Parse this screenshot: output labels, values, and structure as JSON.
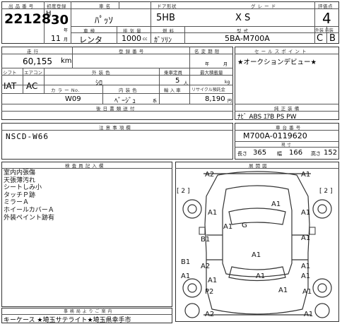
{
  "labels": {
    "lot_no": "出 品 番 号",
    "first_reg": "初度登録",
    "car_name": "車 名",
    "door": "ドア形状",
    "grade": "グ レ ー ド",
    "score": "評価点",
    "shaken": "車 検",
    "displacement": "排 気 量",
    "fuel": "燃 料",
    "model_type": "型 式",
    "ext_int": "外装 内装",
    "mileage": "走 行",
    "reg_no": "登 録 番 号",
    "name_change": "名 変 期 限",
    "sales_point": "セ ー ル ス ポ イ ン ト",
    "shift": "シフト",
    "ac": "エアコン",
    "ext_color": "外 装 色",
    "capacity": "乗車定員",
    "max_load": "最大積載量",
    "color_no": "カ ラ ー No.",
    "int_color": "内 装 色",
    "import": "輸 入 車",
    "recycle": "リサイクル預託金",
    "rear_equipment": "後 日 書 類 送 付",
    "genuine_equip": "純 正 装 備",
    "notes": "注 意 事 項 欄",
    "chassis_no": "車 台 番 号",
    "dimensions": "現 寸",
    "inspector_notes": "検 査 員 記 入 欄",
    "diagram": "展 開 図",
    "office_note": "事 務 局 よ り ご 案 内"
  },
  "car": {
    "lot_no": "22128",
    "era": "H",
    "year": "30",
    "month": "11",
    "month_unit": "月",
    "year_unit": "年",
    "name": "ﾊﾟｯｿ",
    "door": "5HB",
    "grade": "X S",
    "score": "4",
    "shaken": "レンタ",
    "displacement": "1000",
    "displacement_unit": "cc",
    "fuel": "ｶﾞｿﾘﾝ",
    "model_type": "5BA-M700A",
    "ext_grade": "C",
    "int_grade": "B",
    "mileage": "60,155",
    "mileage_unit": "km",
    "reg_year_unit": "年",
    "reg_month_unit": "月",
    "sales_point": "★オークションデビュー★",
    "shift": "IAT",
    "ac": "AC",
    "ext_color": "ｼﾛ",
    "capacity": "5",
    "capacity_unit": "人",
    "load_unit": "kg",
    "color_no": "W09",
    "int_color": "ﾍﾞｰｼﾞｭ",
    "int_color_unit": "系",
    "recycle": "8,190",
    "recycle_unit": "円",
    "equipment": "ﾅﾋﾞ  ABS  ｴｱB  PS  PW",
    "notes": "NSCD-W66",
    "chassis_no": "M700A-0119620",
    "len_label": "長さ",
    "len": "365",
    "width_label": "幅",
    "width": "166",
    "height_label": "高さ",
    "height": "152"
  },
  "inspector_lines": [
    "室内内張傷",
    "天張薄汚れ",
    "シートしみ小",
    "タッチＰ跡",
    "ミラーＡ",
    "ホイールカバーＡ",
    "外装ペイント跡有"
  ],
  "office_text": "キーケース ★埼玉サテライト★埼玉県幸手市",
  "damage_marks": [
    "A2",
    "A1",
    "A1",
    "A1",
    "A1",
    "A1",
    "G",
    "B1",
    "A1",
    "A1",
    "B1",
    "A2",
    "A1",
    "A1",
    "A1",
    "A1",
    "A1",
    "P2",
    "A1",
    "A1",
    "A2",
    "A1"
  ],
  "bracket_marks": [
    "[ 2 ]",
    "[ 2 ]"
  ]
}
